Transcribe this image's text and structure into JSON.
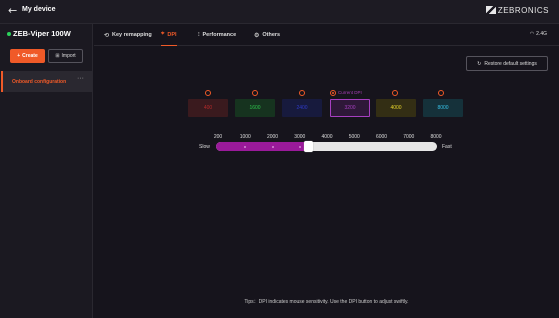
{
  "header": {
    "back_icon": "arrow-left-icon",
    "title": "My device",
    "brand": "ZEBRONICS"
  },
  "sidebar": {
    "device_name": "ZEB-Viper 100W",
    "status_color": "#2bd15b",
    "create_label": "Create",
    "import_label": "Import",
    "config_label": "Onboard configuration",
    "more_label": "···"
  },
  "tabs": [
    {
      "label": "Key remapping",
      "icon": "key-remap-icon",
      "active": false
    },
    {
      "label": "DPI",
      "icon": "crosshair-icon",
      "active": true
    },
    {
      "label": "Performance",
      "icon": "sliders-icon",
      "active": false
    },
    {
      "label": "Others",
      "icon": "gear-icon",
      "active": false
    }
  ],
  "connection": {
    "label": "2.4G",
    "icon": "wifi-icon"
  },
  "restore_label": "Restore default settings",
  "dpi": {
    "current_label": "Current DPI",
    "selected_index": 3,
    "levels": [
      {
        "value": "400",
        "text_color": "#b42a2a",
        "bg": "#3a1a1e"
      },
      {
        "value": "1600",
        "text_color": "#2ec44d",
        "bg": "#16331f"
      },
      {
        "value": "2400",
        "text_color": "#2f3ac8",
        "bg": "#171a3d"
      },
      {
        "value": "3200",
        "text_color": "#a63fc0",
        "bg": "#2e1838"
      },
      {
        "value": "4000",
        "text_color": "#e8d42a",
        "bg": "#332e14"
      },
      {
        "value": "8000",
        "text_color": "#38c2e8",
        "bg": "#15313a"
      }
    ]
  },
  "slider": {
    "ticks": [
      "200",
      "1000",
      "2000",
      "3000",
      "4000",
      "5000",
      "6000",
      "7000",
      "8000"
    ],
    "min_label": "Slow",
    "max_label": "Fast",
    "value": 3200,
    "fill_color": "#9a1a9a"
  },
  "tips": "Tips：DPI indicates mouse sensitivity. Use the DPI button to adjust swiftly."
}
